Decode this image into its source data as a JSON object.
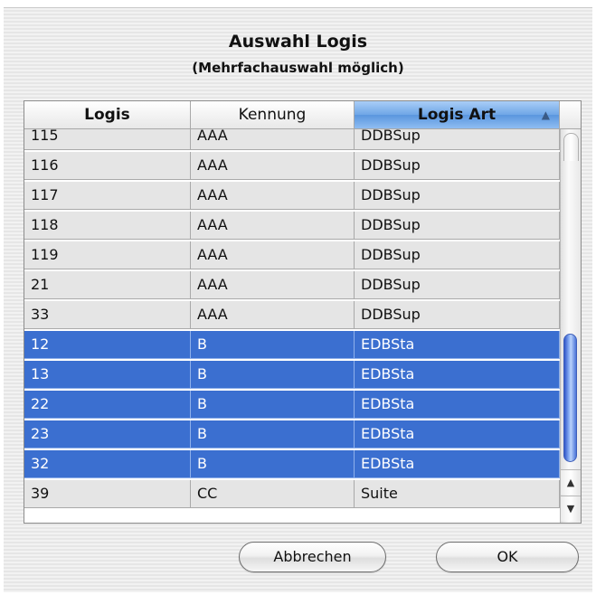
{
  "dialog": {
    "title": "Auswahl Logis",
    "subtitle": "(Mehrfachauswahl möglich)"
  },
  "table": {
    "columns": [
      {
        "label": "Logis"
      },
      {
        "label": "Kennung"
      },
      {
        "label": "Logis Art",
        "sorted": true,
        "sort_direction": "ascending"
      }
    ],
    "sort_indicator": "▲",
    "rows": [
      {
        "logis": "115",
        "kennung": "AAA",
        "art": "DDBSup",
        "selected": false
      },
      {
        "logis": "116",
        "kennung": "AAA",
        "art": "DDBSup",
        "selected": false
      },
      {
        "logis": "117",
        "kennung": "AAA",
        "art": "DDBSup",
        "selected": false
      },
      {
        "logis": "118",
        "kennung": "AAA",
        "art": "DDBSup",
        "selected": false
      },
      {
        "logis": "119",
        "kennung": "AAA",
        "art": "DDBSup",
        "selected": false
      },
      {
        "logis": "21",
        "kennung": "AAA",
        "art": "DDBSup",
        "selected": false
      },
      {
        "logis": "33",
        "kennung": "AAA",
        "art": "DDBSup",
        "selected": false
      },
      {
        "logis": "12",
        "kennung": "B",
        "art": "EDBSta",
        "selected": true
      },
      {
        "logis": "13",
        "kennung": "B",
        "art": "EDBSta",
        "selected": true
      },
      {
        "logis": "22",
        "kennung": "B",
        "art": "EDBSta",
        "selected": true
      },
      {
        "logis": "23",
        "kennung": "B",
        "art": "EDBSta",
        "selected": true
      },
      {
        "logis": "32",
        "kennung": "B",
        "art": "EDBSta",
        "selected": true
      },
      {
        "logis": "39",
        "kennung": "CC",
        "art": "Suite",
        "selected": false
      }
    ]
  },
  "scrollbar": {
    "up_arrow": "▲",
    "down_arrow": "▼"
  },
  "buttons": {
    "cancel_label": "Abbrechen",
    "ok_label": "OK"
  },
  "colors": {
    "selection": "#3b6fd0",
    "sorted_header": "#6fa6e6"
  }
}
